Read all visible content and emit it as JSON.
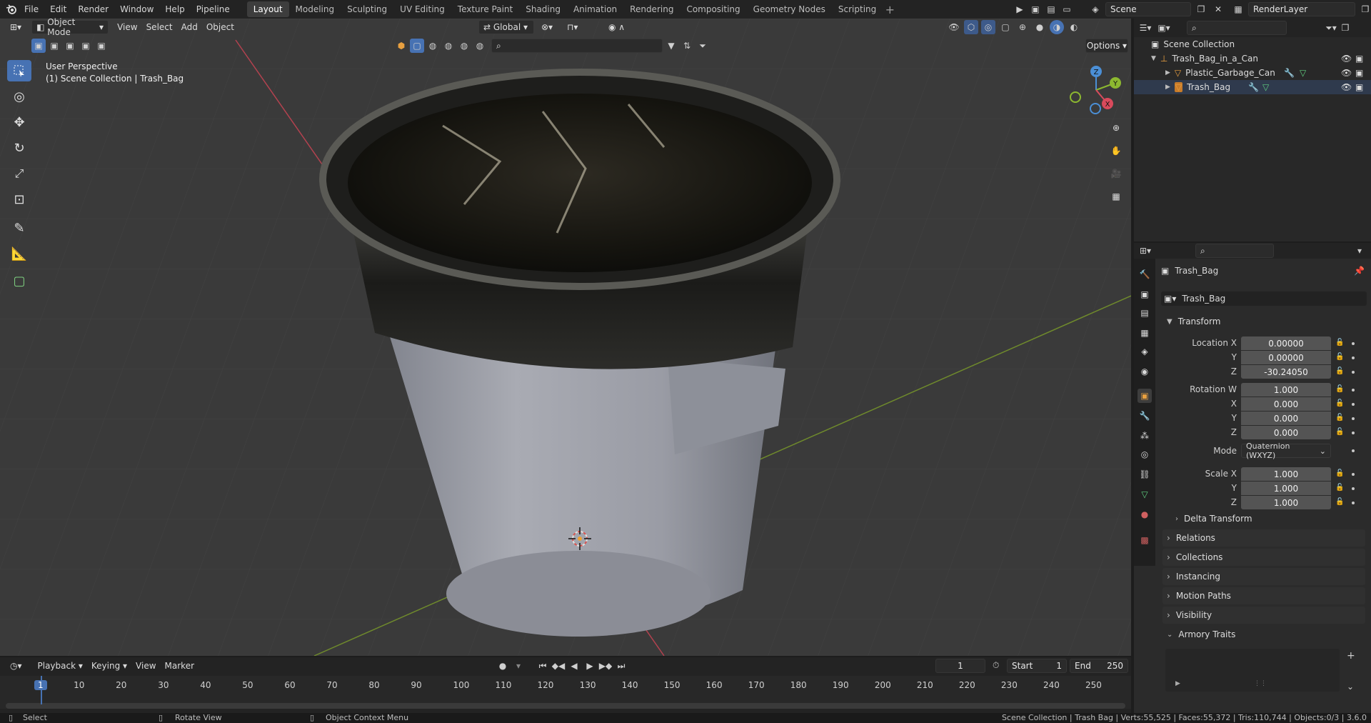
{
  "menu": [
    "File",
    "Edit",
    "Render",
    "Window",
    "Help",
    "Pipeline"
  ],
  "workspaces": [
    "Layout",
    "Modeling",
    "Sculpting",
    "UV Editing",
    "Texture Paint",
    "Shading",
    "Animation",
    "Rendering",
    "Compositing",
    "Geometry Nodes",
    "Scripting"
  ],
  "active_workspace": "Layout",
  "scene_name": "Scene",
  "view_layer": "RenderLayer",
  "viewport": {
    "mode": "Object Mode",
    "menus": [
      "View",
      "Select",
      "Add",
      "Object"
    ],
    "transform_orientation": "Global",
    "options_label": "Options",
    "perspective_label": "User Perspective",
    "collection_label": "(1) Scene Collection | Trash_Bag"
  },
  "outliner": {
    "root": "Scene Collection",
    "items": [
      {
        "name": "Trash_Bag_in_a_Can",
        "level": 1
      },
      {
        "name": "Plastic_Garbage_Can",
        "level": 2
      },
      {
        "name": "Trash_Bag",
        "level": 2
      }
    ]
  },
  "properties": {
    "object_name": "Trash_Bag",
    "datablock_name": "Trash_Bag",
    "transform_header": "Transform",
    "location": {
      "label_x": "Location X",
      "x": "0.00000",
      "y": "0.00000",
      "z": "-30.24050"
    },
    "rotation": {
      "label_w": "Rotation W",
      "w": "1.000",
      "x": "0.000",
      "y": "0.000",
      "z": "0.000"
    },
    "mode_label": "Mode",
    "mode_value": "Quaternion (WXYZ)",
    "scale": {
      "label_x": "Scale X",
      "x": "1.000",
      "y": "1.000",
      "z": "1.000"
    },
    "axis_labels": {
      "y": "Y",
      "z": "Z",
      "x": "X"
    },
    "delta_transform": "Delta Transform",
    "panels": [
      "Relations",
      "Collections",
      "Instancing",
      "Motion Paths",
      "Visibility",
      "Armory Traits"
    ]
  },
  "timeline": {
    "menus": [
      "Playback",
      "Keying",
      "View",
      "Marker"
    ],
    "current_frame": "1",
    "start_label": "Start",
    "start": "1",
    "end_label": "End",
    "end": "250",
    "ticks": [
      "1",
      "10",
      "20",
      "30",
      "40",
      "50",
      "60",
      "70",
      "80",
      "90",
      "100",
      "110",
      "120",
      "130",
      "140",
      "150",
      "160",
      "170",
      "180",
      "190",
      "200",
      "210",
      "220",
      "230",
      "240",
      "250"
    ]
  },
  "statusbar": {
    "select": "Select",
    "rotate": "Rotate View",
    "context": "Object Context Menu",
    "stats": "Scene Collection | Trash Bag | Verts:55,525 | Faces:55,372 | Tris:110,744 | Objects:0/3 | 3.6.0"
  },
  "colors": {
    "accent": "#4772b3",
    "x_axis": "#d94a5c",
    "y_axis": "#8cb830",
    "z_axis": "#4b8fd6"
  }
}
